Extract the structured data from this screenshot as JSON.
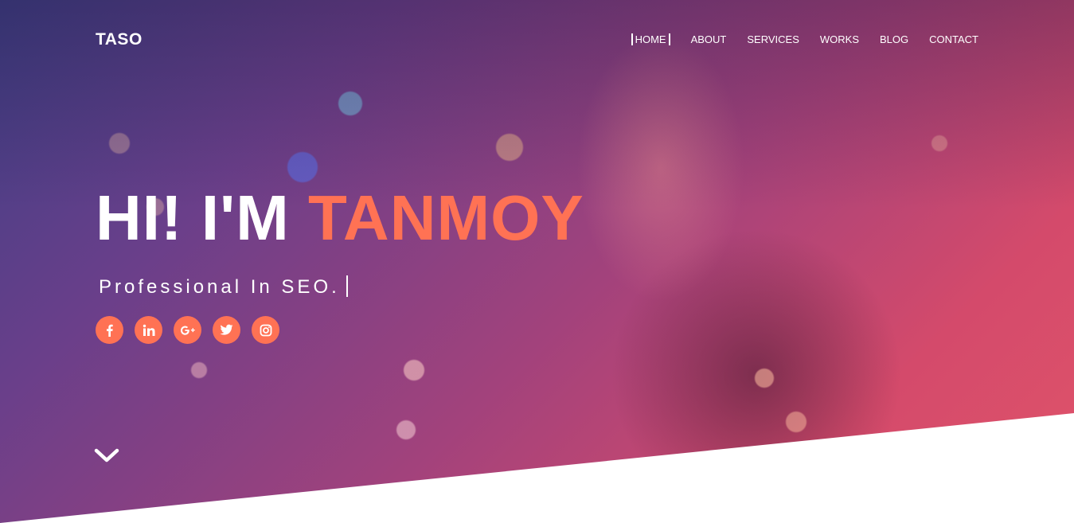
{
  "header": {
    "logo": "TASO",
    "nav": [
      {
        "label": "HOME",
        "active": true
      },
      {
        "label": "ABOUT",
        "active": false
      },
      {
        "label": "SERVICES",
        "active": false
      },
      {
        "label": "WORKS",
        "active": false
      },
      {
        "label": "BLOG",
        "active": false
      },
      {
        "label": "CONTACT",
        "active": false
      }
    ]
  },
  "hero": {
    "greeting": "HI! I'M ",
    "name": "TANMOY",
    "subtitle": "Professional In SEO."
  },
  "social_links": [
    {
      "icon": "facebook-icon"
    },
    {
      "icon": "linkedin-icon"
    },
    {
      "icon": "google-plus-icon"
    },
    {
      "icon": "twitter-icon"
    },
    {
      "icon": "instagram-icon"
    }
  ],
  "scroll_icon": "chevron-down-icon",
  "colors": {
    "accent": "#ff7254",
    "text": "#ffffff",
    "overlay_start": "#3f3f86",
    "overlay_end": "#e0546a"
  }
}
